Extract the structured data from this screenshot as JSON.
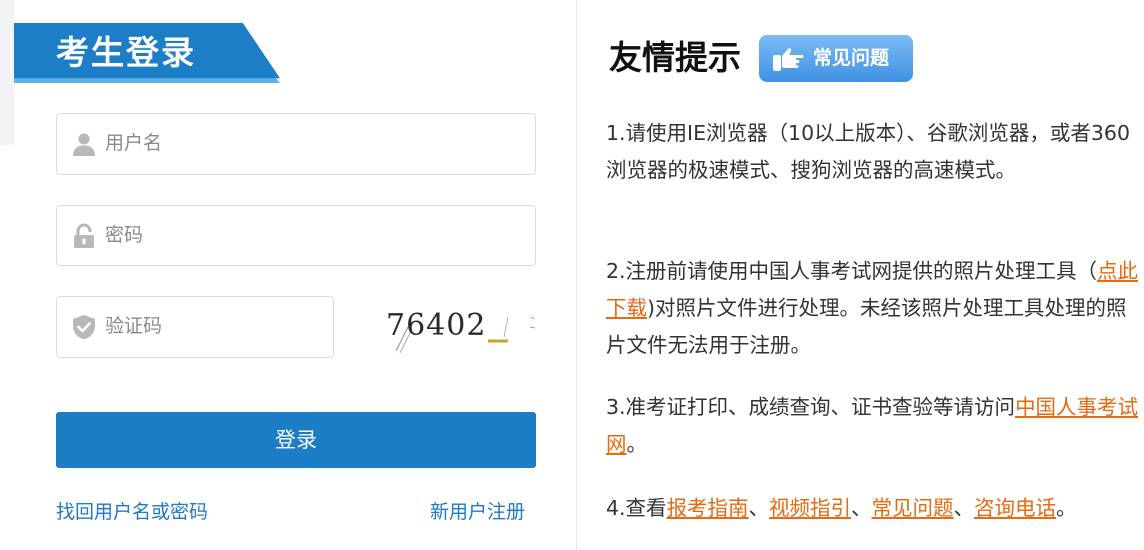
{
  "login": {
    "title": "考生登录",
    "username_placeholder": "用户名",
    "password_placeholder": "密码",
    "captcha_placeholder": "验证码",
    "captcha_text": "76402",
    "submit_label": "登录",
    "forgot_link": "找回用户名或密码",
    "register_link": "新用户注册"
  },
  "tips": {
    "title": "友情提示",
    "faq_badge": "常见问题",
    "tip1": "1.请使用IE浏览器（10以上版本）、谷歌浏览器，或者360浏览器的极速模式、搜狗浏览器的高速模式。",
    "tip2_pre": "2.注册前请使用中国人事考试网提供的照片处理工具（",
    "tip2_link": "点此下载",
    "tip2_post": ")对照片文件进行处理。未经该照片处理工具处理的照片文件无法用于注册。",
    "tip3_pre": "3.准考证打印、成绩查询、证书查验等请访问",
    "tip3_link": "中国人事考试网",
    "tip3_post": "。",
    "tip4_pre": "4.查看",
    "tip4_link1": "报考指南",
    "tip4_sep1": "、",
    "tip4_link2": "视频指引",
    "tip4_sep2": "、",
    "tip4_link3": "常见问题",
    "tip4_sep3": "、",
    "tip4_link4": "咨询电话",
    "tip4_post": "。"
  },
  "colors": {
    "primary": "#1b7dc6",
    "link_blue": "#1f78c8",
    "link_orange": "#e66a10"
  }
}
